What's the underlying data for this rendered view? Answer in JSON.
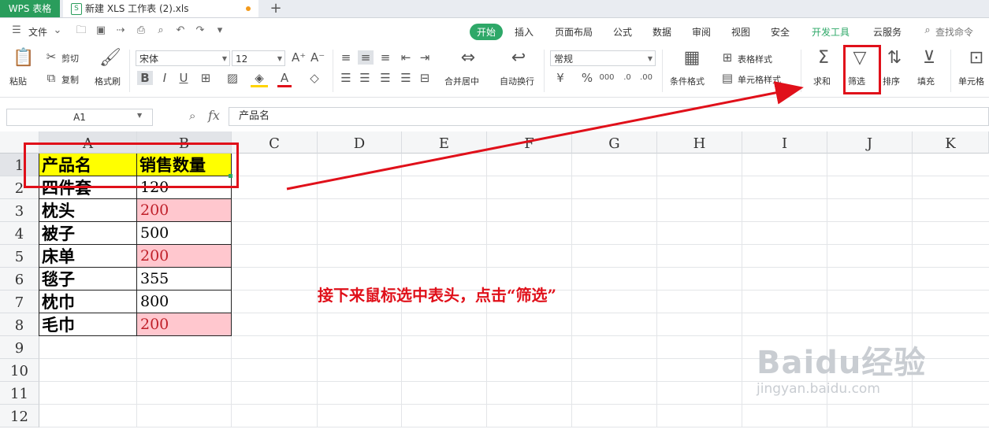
{
  "titlebar": {
    "app_tab": "WPS 表格",
    "doc_tab": "新建 XLS 工作表 (2).xls",
    "new_tab": "+"
  },
  "menu": {
    "file": "文件",
    "tabs": [
      "开始",
      "插入",
      "页面布局",
      "公式",
      "数据",
      "审阅",
      "视图",
      "安全",
      "开发工具",
      "云服务"
    ],
    "search": "查找命令"
  },
  "ribbon": {
    "paste": "粘贴",
    "cut": "剪切",
    "copy": "复制",
    "format_painter": "格式刷",
    "font_name": "宋体",
    "font_size": "12",
    "merge_center": "合并居中",
    "wrap_text": "自动换行",
    "number_format": "常规",
    "conditional_format": "条件格式",
    "table_style": "表格样式",
    "cell_style": "单元格样式",
    "sum": "求和",
    "filter": "筛选",
    "sort": "排序",
    "fill": "填充",
    "cell": "单元格"
  },
  "formula_bar": {
    "name_box": "A1",
    "fx": "fx",
    "value": "产品名"
  },
  "sheet": {
    "columns": [
      "A",
      "B",
      "C",
      "D",
      "E",
      "F",
      "G",
      "H",
      "I",
      "J",
      "K"
    ],
    "rows": [
      "1",
      "2",
      "3",
      "4",
      "5",
      "6",
      "7",
      "8",
      "9",
      "10",
      "11",
      "12"
    ],
    "header": [
      "产品名",
      "销售数量"
    ],
    "data": [
      {
        "name": "四件套",
        "qty": "120",
        "highlight": false
      },
      {
        "name": "枕头",
        "qty": "200",
        "highlight": true
      },
      {
        "name": "被子",
        "qty": "500",
        "highlight": false
      },
      {
        "name": "床单",
        "qty": "200",
        "highlight": true
      },
      {
        "name": "毯子",
        "qty": "355",
        "highlight": false
      },
      {
        "name": "枕巾",
        "qty": "800",
        "highlight": false
      },
      {
        "name": "毛巾",
        "qty": "200",
        "highlight": true
      }
    ]
  },
  "annotation": "接下来鼠标选中表头，点击“筛选”",
  "watermark": {
    "brand": "Baidu经验",
    "url": "jingyan.baidu.com"
  },
  "colors": {
    "accent": "#2ea868",
    "annotation_red": "#e0101a",
    "header_fill": "#ffff00",
    "highlight_fill": "#ffc7ce",
    "highlight_text": "#c0202a"
  }
}
